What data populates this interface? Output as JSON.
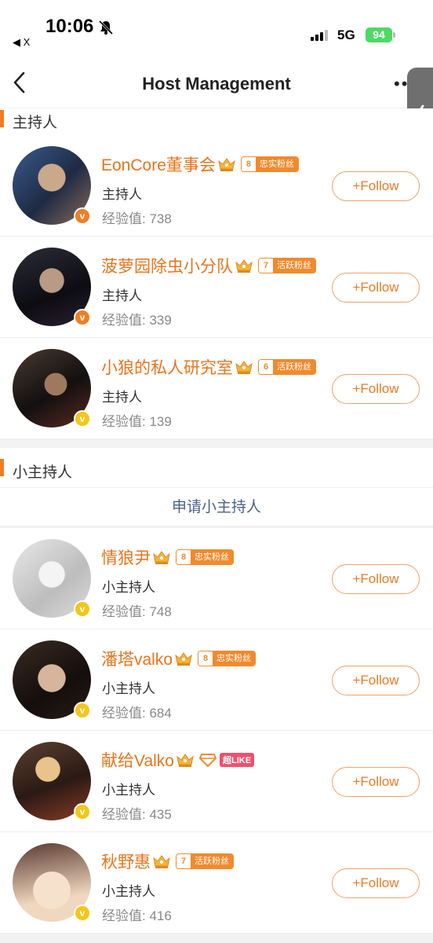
{
  "status_bar": {
    "time": "10:06",
    "back_app": "◀ X",
    "network": "5G",
    "battery": "94"
  },
  "navbar": {
    "title": "Host Management",
    "more": "••"
  },
  "sections": {
    "hosts": {
      "label": "主持人"
    },
    "sub_hosts": {
      "label": "小主持人",
      "apply_label": "申请小主持人"
    }
  },
  "colors": {
    "accent": "#f07d22",
    "name_orange": "#e8741c",
    "badge_orange": "#f07d22",
    "badge_yellow": "#f5c518",
    "link_blue": "#4a6485"
  },
  "hosts": [
    {
      "name": "EonCore董事会",
      "fan_level": "8",
      "fan_label": "忠实粉丝",
      "role": "主持人",
      "exp": "经验值: 738",
      "badge_color": "orange",
      "follow_label": "+Follow"
    },
    {
      "name": "菠萝园除虫小分队",
      "fan_level": "7",
      "fan_label": "活跃粉丝",
      "role": "主持人",
      "exp": "经验值: 339",
      "badge_color": "orange",
      "follow_label": "+Follow"
    },
    {
      "name": "小狼的私人研究室",
      "fan_level": "6",
      "fan_label": "活跃粉丝",
      "role": "主持人",
      "exp": "经验值: 139",
      "badge_color": "yellow",
      "follow_label": "+Follow"
    }
  ],
  "sub_hosts": [
    {
      "name": "情狼尹",
      "fan_level": "8",
      "fan_label": "忠实粉丝",
      "role": "小主持人",
      "exp": "经验值: 748",
      "badge_color": "yellow",
      "follow_label": "+Follow"
    },
    {
      "name": "潘塔valko",
      "fan_level": "8",
      "fan_label": "忠实粉丝",
      "role": "小主持人",
      "exp": "经验值: 684",
      "badge_color": "yellow",
      "follow_label": "+Follow"
    },
    {
      "name": "献给Valko",
      "super_like": "超LIKE",
      "role": "小主持人",
      "exp": "经验值: 435",
      "badge_color": "yellow",
      "follow_label": "+Follow"
    },
    {
      "name": "秋野惠",
      "fan_level": "7",
      "fan_label": "活跃粉丝",
      "role": "小主持人",
      "exp": "经验值: 416",
      "badge_color": "yellow",
      "follow_label": "+Follow"
    }
  ]
}
